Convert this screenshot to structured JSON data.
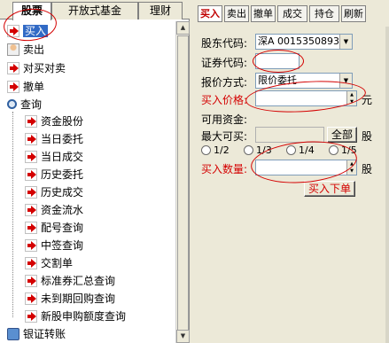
{
  "top_tabs": [
    "股票",
    "开放式基金",
    "理财"
  ],
  "tree": [
    {
      "label": "买入",
      "icon": "buy-icon",
      "selected": true
    },
    {
      "label": "卖出",
      "icon": "sell-icon"
    },
    {
      "label": "对买对卖",
      "icon": "arrow-icon"
    },
    {
      "label": "撤单",
      "icon": "arrow-icon"
    },
    {
      "label": "查询",
      "icon": "magnifier-icon"
    },
    {
      "label": "资金股份",
      "icon": "arrow-icon"
    },
    {
      "label": "当日委托",
      "icon": "arrow-icon"
    },
    {
      "label": "当日成交",
      "icon": "arrow-icon"
    },
    {
      "label": "历史委托",
      "icon": "arrow-icon"
    },
    {
      "label": "历史成交",
      "icon": "arrow-icon"
    },
    {
      "label": "资金流水",
      "icon": "arrow-icon"
    },
    {
      "label": "配号查询",
      "icon": "arrow-icon"
    },
    {
      "label": "中签查询",
      "icon": "arrow-icon"
    },
    {
      "label": "交割单",
      "icon": "arrow-icon"
    },
    {
      "label": "标准券汇总查询",
      "icon": "arrow-icon"
    },
    {
      "label": "未到期回购查询",
      "icon": "arrow-icon"
    },
    {
      "label": "新股申购额度查询",
      "icon": "arrow-icon"
    },
    {
      "label": "银证转账",
      "icon": "bank-icon"
    }
  ],
  "right_tabs": [
    "买入",
    "卖出",
    "撤单",
    "成交",
    "持仓",
    "刷新"
  ],
  "form": {
    "account_label": "股东代码:",
    "account_value": "深A 0015350893",
    "code_label": "证券代码:",
    "code_value": "",
    "price_type_label": "报价方式:",
    "price_type_value": "限价委托",
    "price_label": "买入价格:",
    "price_value": "",
    "price_unit": "元",
    "funds_label": "可用资金:",
    "funds_value": "",
    "max_label": "最大可买:",
    "max_value": "",
    "all_button": "全部",
    "max_unit": "股",
    "ratios": [
      "1/2",
      "1/3",
      "1/4",
      "1/5"
    ],
    "qty_label": "买入数量:",
    "qty_value": "",
    "qty_unit": "股",
    "submit_button": "买入下单"
  },
  "colors": {
    "accent_red": "#d40000",
    "selection": "#316ac5"
  }
}
